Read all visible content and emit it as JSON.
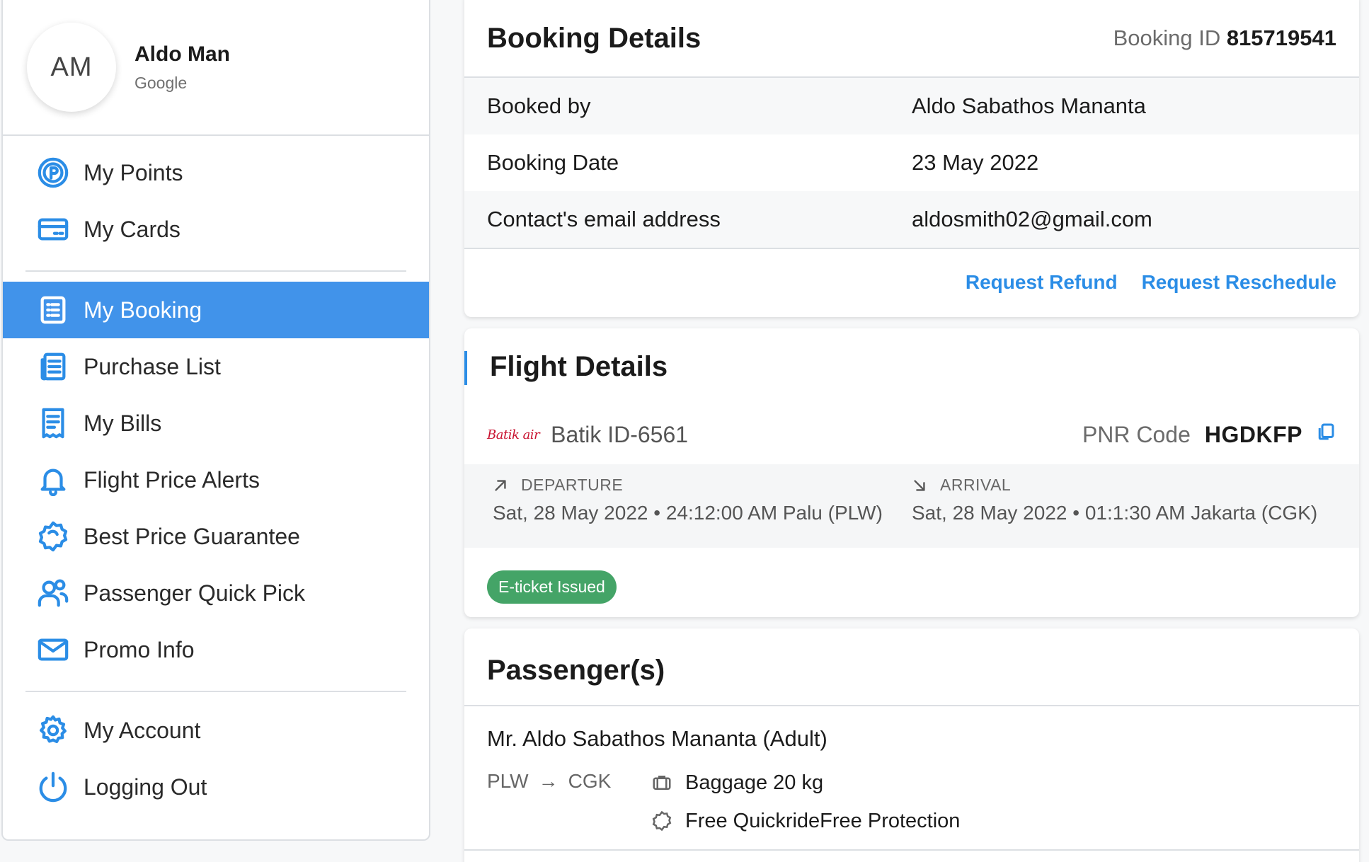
{
  "profile": {
    "initials": "AM",
    "name": "Aldo Man",
    "provider": "Google"
  },
  "sidebar": {
    "group1": [
      {
        "label": "My Points",
        "icon": "points-icon"
      },
      {
        "label": "My Cards",
        "icon": "card-icon"
      }
    ],
    "group2": [
      {
        "label": "My Booking",
        "icon": "booking-icon",
        "active": true
      },
      {
        "label": "Purchase List",
        "icon": "purchase-list-icon"
      },
      {
        "label": "My Bills",
        "icon": "bills-icon"
      },
      {
        "label": "Flight Price Alerts",
        "icon": "bell-icon"
      },
      {
        "label": "Best Price Guarantee",
        "icon": "badge-icon"
      },
      {
        "label": "Passenger Quick Pick",
        "icon": "users-icon"
      },
      {
        "label": "Promo Info",
        "icon": "mail-icon"
      }
    ],
    "group3": [
      {
        "label": "My Account",
        "icon": "gear-icon"
      },
      {
        "label": "Logging Out",
        "icon": "power-icon"
      }
    ]
  },
  "booking": {
    "title": "Booking Details",
    "id_label": "Booking ID",
    "id_value": "815719541",
    "rows": [
      {
        "label": "Booked by",
        "value": "Aldo Sabathos Mananta"
      },
      {
        "label": "Booking Date",
        "value": "23 May 2022"
      },
      {
        "label": "Contact's email address",
        "value": "aldosmith02@gmail.com"
      }
    ],
    "refund_label": "Request Refund",
    "reschedule_label": "Request Reschedule"
  },
  "flight": {
    "title": "Flight Details",
    "airline_logo_text": "Batik air",
    "airline_name": "Batik ID-6561",
    "pnr_label": "PNR Code",
    "pnr_value": "HGDKFP",
    "departure_label": "DEPARTURE",
    "departure_detail": "Sat, 28 May 2022 • 24:12:00 AM Palu (PLW)",
    "arrival_label": "ARRIVAL",
    "arrival_detail": "Sat, 28 May 2022 • 01:1:30 AM Jakarta (CGK)",
    "status_badge": "E-ticket Issued",
    "colors": {
      "accent": "#2b8de6",
      "badge": "#44a467",
      "logo": "#c8102e"
    }
  },
  "passengers": {
    "title": "Passenger(s)",
    "items": [
      {
        "name": "Mr. Aldo Sabathos Mananta (Adult)",
        "from": "PLW",
        "to": "CGK",
        "baggage": "Baggage 20 kg",
        "protection": "Free QuickrideFree Protection"
      }
    ]
  }
}
